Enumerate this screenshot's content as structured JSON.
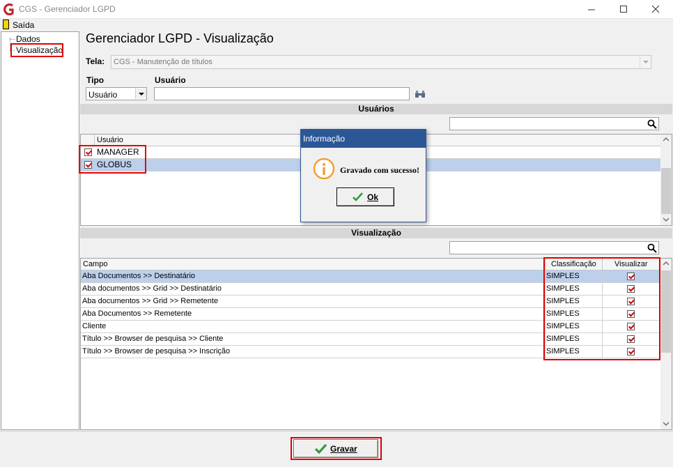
{
  "window": {
    "title": "CGS - Gerenciador LGPD"
  },
  "menu": {
    "exit_label": "Saída"
  },
  "sidebar": {
    "items": [
      {
        "label": "Dados"
      },
      {
        "label": "Visualização"
      }
    ]
  },
  "page": {
    "title": "Gerenciador LGPD - Visualização"
  },
  "form": {
    "tela_label": "Tela:",
    "tela_value": "CGS - Manutenção de títulos",
    "tipo_label": "Tipo",
    "tipo_value": "Usuário",
    "usuario_label": "Usuário",
    "usuario_value": ""
  },
  "users_section": {
    "title": "Usuários",
    "search_value": "",
    "column": "Usuário",
    "rows": [
      {
        "name": "MANAGER",
        "checked": true,
        "selected": false
      },
      {
        "name": "GLOBUS",
        "checked": true,
        "selected": true
      }
    ]
  },
  "visualization_section": {
    "title": "Visualização",
    "search_value": "",
    "columns": {
      "campo": "Campo",
      "classificacao": "Classificação",
      "visualizar": "Visualizar"
    },
    "rows": [
      {
        "campo": "Aba Documentos >> Destinatário",
        "classificacao": "SIMPLES",
        "visualizar": true,
        "selected": true
      },
      {
        "campo": "Aba documentos >> Grid  >> Destinatário",
        "classificacao": "SIMPLES",
        "visualizar": true,
        "selected": false
      },
      {
        "campo": "Aba documentos >> Grid  >> Remetente",
        "classificacao": "SIMPLES",
        "visualizar": true,
        "selected": false
      },
      {
        "campo": "Aba Documentos >> Remetente",
        "classificacao": "SIMPLES",
        "visualizar": true,
        "selected": false
      },
      {
        "campo": "Cliente",
        "classificacao": "SIMPLES",
        "visualizar": true,
        "selected": false
      },
      {
        "campo": "Título >> Browser de pesquisa >> Cliente",
        "classificacao": "SIMPLES",
        "visualizar": true,
        "selected": false
      },
      {
        "campo": "Título >> Browser de pesquisa >> Inscrição",
        "classificacao": "SIMPLES",
        "visualizar": true,
        "selected": false
      }
    ]
  },
  "dialog": {
    "title": "Informação",
    "message": "Gravado com sucesso!",
    "ok_label": "Ok"
  },
  "footer": {
    "save_label": "Gravar"
  },
  "colors": {
    "accent": "#2b5797",
    "selection": "#bcd0ec",
    "highlight": "#e00000",
    "check": "#cc0000",
    "ok_green": "#2f9e3a",
    "logo": "#c0272d",
    "info_icon": "#f0a030"
  },
  "icons": {
    "app": "cgs-logo-icon",
    "exit": "exit-door-icon",
    "minimize": "minimize-icon",
    "maximize": "maximize-icon",
    "close": "close-icon",
    "binoculars": "binoculars-icon",
    "search": "search-icon",
    "info": "info-icon",
    "check": "check-icon"
  }
}
